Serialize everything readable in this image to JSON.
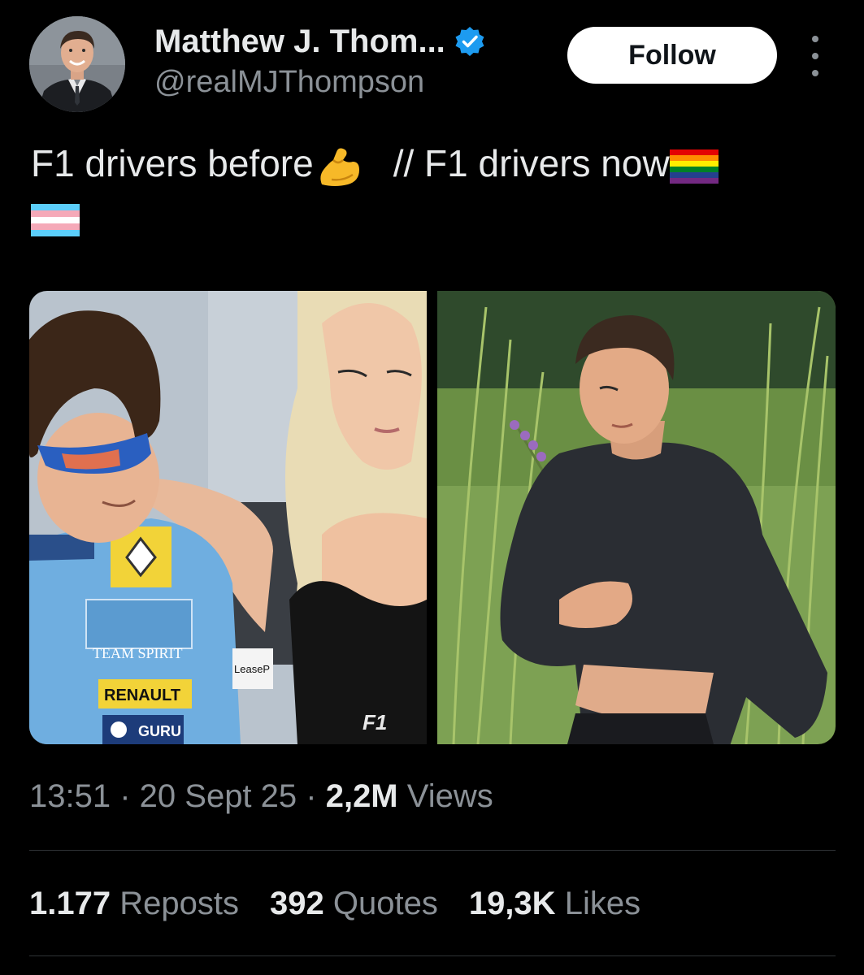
{
  "author": {
    "display_name": "Matthew J. Thom...",
    "handle": "@realMJThompson",
    "verified": true,
    "verified_color": "#1d9bf0",
    "avatar_icon": "person-photo"
  },
  "actions": {
    "follow_label": "Follow",
    "more_icon": "more-vertical-icon"
  },
  "tweet": {
    "text_part1": "F1 drivers before",
    "emoji1": "flexed-biceps",
    "text_part2": "// F1 drivers now",
    "emoji2": "rainbow-flag",
    "emoji3": "transgender-flag"
  },
  "media": {
    "images": [
      {
        "name": "left-image",
        "texts": [
          "TEAM SPIRIT",
          "RENAULT",
          "GURU",
          "LeaseP"
        ]
      },
      {
        "name": "right-image"
      }
    ],
    "left_texts": {
      "team_spirit": "TEAM SPIRIT",
      "renault": "RENAULT",
      "guru": "GURU",
      "leasep": "LeaseP"
    }
  },
  "meta": {
    "time": "13:51",
    "separator": " · ",
    "date": "20 Sept 25",
    "views_count": "2,2M",
    "views_label": "Views"
  },
  "stats": {
    "reposts_count": "1.177",
    "reposts_label": "Reposts",
    "quotes_count": "392",
    "quotes_label": "Quotes",
    "likes_count": "19,3K",
    "likes_label": "Likes"
  },
  "colors": {
    "background": "#000000",
    "primary_text": "#e7e9ea",
    "secondary_text": "#8b9197",
    "divider": "#2f3336",
    "follow_bg": "#ffffff"
  }
}
